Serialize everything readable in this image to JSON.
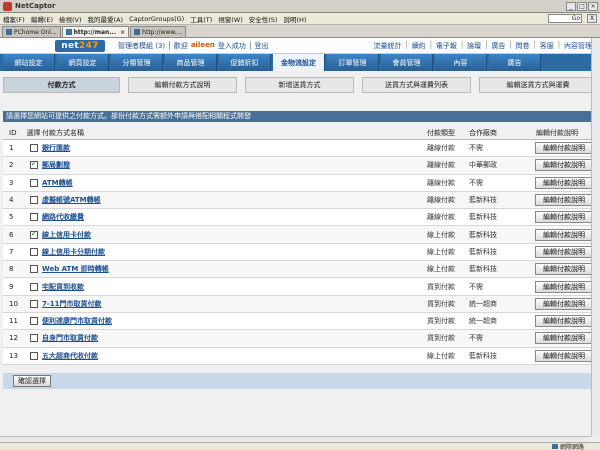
{
  "window": {
    "title": "NetCaptor",
    "search_text": "Go",
    "close": "X"
  },
  "menu": [
    "檔案(F)",
    "編輯(E)",
    "檢視(V)",
    "我的最愛(A)",
    "CaptorGroups(G)",
    "工具(T)",
    "視窗(W)",
    "安全性(S)",
    "說明(H)"
  ],
  "browser_tabs": [
    {
      "label": "PChome Onl...",
      "active": false
    },
    {
      "label": "http://man...",
      "active": true
    },
    {
      "label": "http://www....",
      "active": false
    }
  ],
  "site": {
    "logo_text": "net",
    "logo_num": "247",
    "user_prefix": "管理者模組 (3) │ 歡迎",
    "user_name": "aileen",
    "user_suffix": "登入成功 │ 登出",
    "top_links": [
      "流量統計",
      "續約",
      "電子報",
      "論壇",
      "廣告",
      "問卷",
      "客服",
      "內容管理"
    ]
  },
  "nav": [
    {
      "label": "網站設定",
      "active": false
    },
    {
      "label": "網頁設定",
      "active": false
    },
    {
      "label": "分類管理",
      "active": false
    },
    {
      "label": "商品管理",
      "active": false
    },
    {
      "label": "促銷折扣",
      "active": false
    },
    {
      "label": "金物流設定",
      "active": true
    },
    {
      "label": "訂單管理",
      "active": false
    },
    {
      "label": "會員管理",
      "active": false
    },
    {
      "label": "內容",
      "active": false
    },
    {
      "label": "廣告",
      "active": false
    }
  ],
  "subnav": [
    {
      "label": "付款方式",
      "active": true,
      "w": 117
    },
    {
      "label": "編輯付款方式說明",
      "active": false,
      "w": 109
    },
    {
      "label": "新增送貨方式",
      "active": false,
      "w": 109
    },
    {
      "label": "送貨方式與運費列表",
      "active": false,
      "w": 109
    },
    {
      "label": "編輯送貨方式與運費",
      "active": false,
      "w": 118
    }
  ],
  "notice": "請選擇您網站可提供之付款方式。部份付款方式需額外申請與搭配相關程式開發",
  "table": {
    "headers": {
      "id": "ID",
      "select": "選擇",
      "name": "付款方式名稱",
      "type": "付款類型",
      "org": "合作廠商",
      "action": "編輯付款說明"
    },
    "rows": [
      {
        "id": "1",
        "checked": false,
        "name": "銀行匯款",
        "type": "離線付款",
        "org": "不需",
        "action": "編輯付款說明"
      },
      {
        "id": "2",
        "checked": true,
        "name": "郵局劃撥",
        "type": "離線付款",
        "org": "中華郵政",
        "action": "編輯付款說明"
      },
      {
        "id": "3",
        "checked": false,
        "name": "ATM轉帳",
        "type": "離線付款",
        "org": "不需",
        "action": "編輯付款說明"
      },
      {
        "id": "4",
        "checked": false,
        "name": "虛擬帳號ATM轉帳",
        "type": "離線付款",
        "org": "藍新科技",
        "action": "編輯付款說明"
      },
      {
        "id": "5",
        "checked": false,
        "name": "網路代收繳費",
        "type": "離線付款",
        "org": "藍新科技",
        "action": "編輯付款說明"
      },
      {
        "id": "6",
        "checked": true,
        "name": "線上信用卡付款",
        "type": "線上付款",
        "org": "藍新科技",
        "action": "編輯付款說明"
      },
      {
        "id": "7",
        "checked": false,
        "name": "線上信用卡分期付款",
        "type": "線上付款",
        "org": "藍新科技",
        "action": "編輯付款說明"
      },
      {
        "id": "8",
        "checked": false,
        "name": "Web ATM 即時轉帳",
        "type": "線上付款",
        "org": "藍新科技",
        "action": "編輯付款說明"
      },
      {
        "id": "9",
        "checked": false,
        "name": "宅配貨到收款",
        "type": "貨到付款",
        "org": "不需",
        "action": "編輯付款說明"
      },
      {
        "id": "10",
        "checked": false,
        "name": "7-11門市取貨付款",
        "type": "貨到付款",
        "org": "統一超商",
        "action": "編輯付款說明"
      },
      {
        "id": "11",
        "checked": false,
        "name": "便利達康門市取貨付款",
        "type": "貨到付款",
        "org": "統一超商",
        "action": "編輯付款說明"
      },
      {
        "id": "12",
        "checked": false,
        "name": "自身門市取貨付款",
        "type": "貨到付款",
        "org": "不需",
        "action": "編輯付款說明"
      },
      {
        "id": "13",
        "checked": false,
        "name": "五大超商代收付款",
        "type": "線上付款",
        "org": "藍新科技",
        "action": "編輯付款說明"
      }
    ]
  },
  "confirm_label": "確認選擇",
  "status": {
    "zone": "網際網路"
  }
}
